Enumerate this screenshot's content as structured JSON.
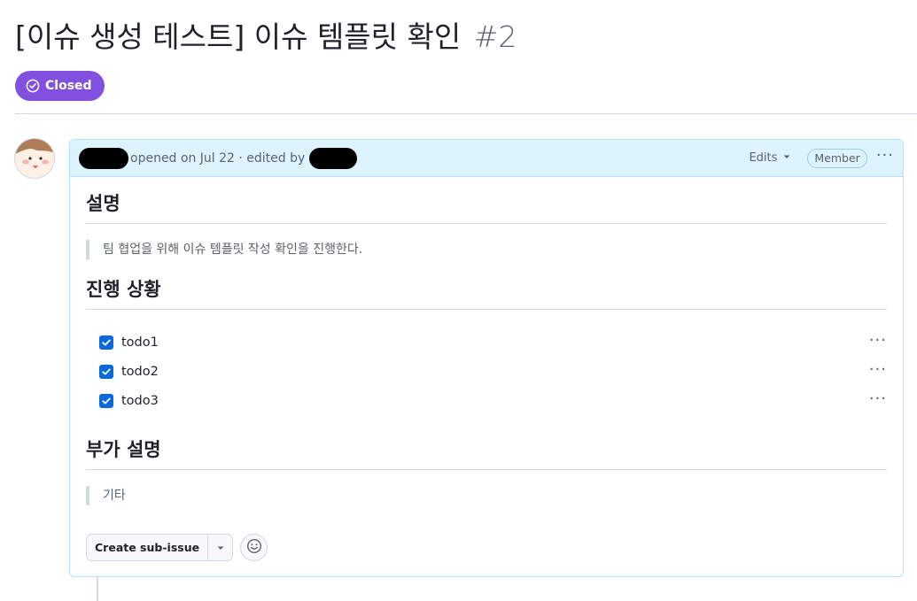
{
  "issue": {
    "title": "[이슈 생성 테스트] 이슈 템플릿 확인",
    "number": "#2",
    "state": "Closed",
    "state_color": "#8250df"
  },
  "comment": {
    "opened_text": "opened on Jul 22 · edited by",
    "edits_label": "Edits",
    "role_badge": "Member",
    "sections": {
      "description_heading": "설명",
      "description_text": "팀 협업을 위해 이슈 템플릿 작성 확인을 진행한다.",
      "progress_heading": "진행 상황",
      "tasks": [
        {
          "label": "todo1",
          "checked": true
        },
        {
          "label": "todo2",
          "checked": true
        },
        {
          "label": "todo3",
          "checked": true
        }
      ],
      "extra_heading": "부가 설명",
      "extra_text": "기타"
    },
    "actions": {
      "create_sub_issue": "Create sub-issue"
    }
  },
  "icons": {
    "state": "check-circle-icon",
    "edits_dropdown": "caret-down-icon",
    "more": "kebab-horizontal-icon",
    "emoji": "smiley-icon"
  },
  "colors": {
    "accent": "#0969da",
    "header_bg": "#ddf4ff",
    "header_border": "#b6e3ff"
  }
}
